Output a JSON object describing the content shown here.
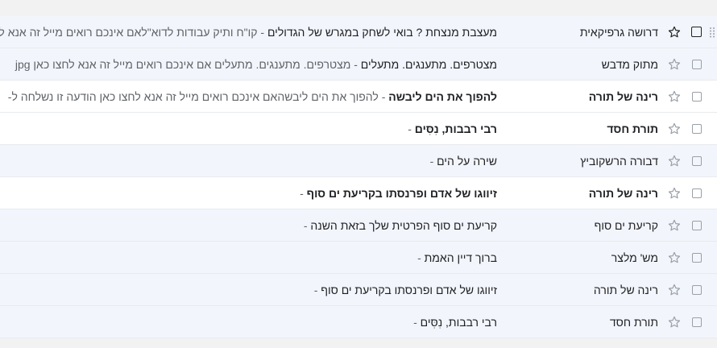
{
  "emails": [
    {
      "sender": "דרושה גרפיקאית",
      "subject": "מעצבת מנצחת ? בואי לשחק במגרש של הגדולים",
      "snippet": " - קו\"ח ותיק עבודות לדוא\"לאם אינכם רואים מייל זה אנא לחצו כאן jpg",
      "unread": false,
      "hover": true
    },
    {
      "sender": "מתוק מדבש",
      "subject": "מצטרפים. מתענגים. מתעלים",
      "snippet": " - מצטרפים. מתענגים. מתעלים אם אינכם רואים מייל זה אנא לחצו כאן jpg",
      "unread": false
    },
    {
      "sender": "רינה של תורה",
      "subject": "להפוך את הים ליבשה",
      "snippet": " - להפוך את הים ליבשהאם אינכם רואים מייל זה אנא לחצו כאן הודעה זו נשלחה ל-",
      "unread": true
    },
    {
      "sender": "תורת חסד",
      "subject": "רבי רבבות, נִסִּים",
      "snippet": " -",
      "unread": true
    },
    {
      "sender": "דבורה הרשקוביץ",
      "subject": "שירה על הים",
      "snippet": " -",
      "unread": false
    },
    {
      "sender": "רינה של תורה",
      "subject": "זיווגו של אדם ופרנסתו בקריעת ים סוף",
      "snippet": " -",
      "unread": true
    },
    {
      "sender": "קריעת ים סוף",
      "subject": "קריעת ים סוף הפרטית שלך בזאת השנה",
      "snippet": " -",
      "unread": false
    },
    {
      "sender": "מש' מלצר",
      "subject": "ברוך דיין האמת",
      "snippet": " -",
      "unread": false
    },
    {
      "sender": "רינה של תורה",
      "subject": "זיווגו של אדם ופרנסתו בקריעת ים סוף",
      "snippet": " -",
      "unread": false
    },
    {
      "sender": "תורת חסד",
      "subject": "רבי רבבות, נִסִּים",
      "snippet": " -",
      "unread": false
    }
  ]
}
